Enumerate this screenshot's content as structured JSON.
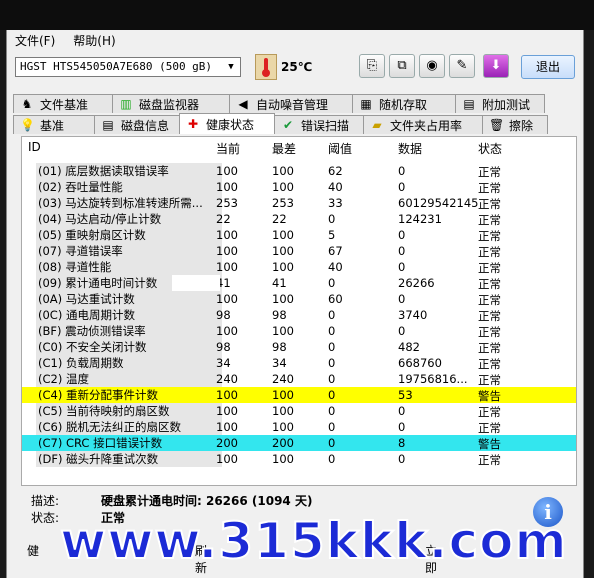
{
  "menu": {
    "file": "文件(F)",
    "help": "帮助(H)"
  },
  "toolbar": {
    "drive": "HGST HTS545050A7E680 (500 gB)",
    "temperature": "25℃",
    "exit_label": "退出"
  },
  "tabs_top": [
    {
      "label": "文件基准",
      "icon": "file-benchmark-icon"
    },
    {
      "label": "磁盘监视器",
      "icon": "disk-monitor-icon"
    },
    {
      "label": "自动噪音管理",
      "icon": "speaker-icon"
    },
    {
      "label": "随机存取",
      "icon": "random-access-icon"
    },
    {
      "label": "附加测试",
      "icon": "extra-tests-icon"
    }
  ],
  "tabs_bottom": [
    {
      "label": "基准",
      "icon": "benchmark-icon"
    },
    {
      "label": "磁盘信息",
      "icon": "disk-info-icon"
    },
    {
      "label": "健康状态",
      "icon": "health-icon"
    },
    {
      "label": "错误扫描",
      "icon": "error-scan-icon"
    },
    {
      "label": "文件夹占用率",
      "icon": "folder-usage-icon"
    },
    {
      "label": "擦除",
      "icon": "erase-icon"
    }
  ],
  "table": {
    "headers": [
      "ID",
      "当前",
      "最差",
      "阈值",
      "数据",
      "状态"
    ],
    "rows": [
      {
        "id": "(01) 底层数据读取错误率",
        "cur": "100",
        "worst": "100",
        "thr": "62",
        "data": "0",
        "status": "正常"
      },
      {
        "id": "(02) 吞吐量性能",
        "cur": "100",
        "worst": "100",
        "thr": "40",
        "data": "0",
        "status": "正常"
      },
      {
        "id": "(03) 马达旋转到标准转速所需...",
        "cur": "253",
        "worst": "253",
        "thr": "33",
        "data": "60129542145",
        "status": "正常"
      },
      {
        "id": "(04) 马达启动/停止计数",
        "cur": "22",
        "worst": "22",
        "thr": "0",
        "data": "124231",
        "status": "正常"
      },
      {
        "id": "(05) 重映射扇区计数",
        "cur": "100",
        "worst": "100",
        "thr": "5",
        "data": "0",
        "status": "正常"
      },
      {
        "id": "(07) 寻道错误率",
        "cur": "100",
        "worst": "100",
        "thr": "67",
        "data": "0",
        "status": "正常"
      },
      {
        "id": "(08) 寻道性能",
        "cur": "100",
        "worst": "100",
        "thr": "40",
        "data": "0",
        "status": "正常"
      },
      {
        "id": "(09) 累计通电时间计数",
        "cur": "41",
        "worst": "41",
        "thr": "0",
        "data": "26266",
        "status": "正常"
      },
      {
        "id": "(0A) 马达重试计数",
        "cur": "100",
        "worst": "100",
        "thr": "60",
        "data": "0",
        "status": "正常"
      },
      {
        "id": "(0C) 通电周期计数",
        "cur": "98",
        "worst": "98",
        "thr": "0",
        "data": "3740",
        "status": "正常"
      },
      {
        "id": "(BF) 震动侦测错误率",
        "cur": "100",
        "worst": "100",
        "thr": "0",
        "data": "0",
        "status": "正常"
      },
      {
        "id": "(C0) 不安全关闭计数",
        "cur": "98",
        "worst": "98",
        "thr": "0",
        "data": "482",
        "status": "正常"
      },
      {
        "id": "(C1) 负载周期数",
        "cur": "34",
        "worst": "34",
        "thr": "0",
        "data": "668760",
        "status": "正常"
      },
      {
        "id": "(C2) 温度",
        "cur": "240",
        "worst": "240",
        "thr": "0",
        "data": "19756816...",
        "status": "正常"
      },
      {
        "id": "(C4) 重新分配事件计数",
        "cur": "100",
        "worst": "100",
        "thr": "0",
        "data": "53",
        "status": "警告"
      },
      {
        "id": "(C5) 当前待映射的扇区数",
        "cur": "100",
        "worst": "100",
        "thr": "0",
        "data": "0",
        "status": "正常"
      },
      {
        "id": "(C6) 脱机无法纠正的扇区数",
        "cur": "100",
        "worst": "100",
        "thr": "0",
        "data": "0",
        "status": "正常"
      },
      {
        "id": "(C7) CRC 接口错误计数",
        "cur": "200",
        "worst": "200",
        "thr": "0",
        "data": "8",
        "status": "警告"
      },
      {
        "id": "(DF) 磁头升降重试次数",
        "cur": "100",
        "worst": "100",
        "thr": "0",
        "data": "0",
        "status": "正常"
      }
    ]
  },
  "description": {
    "desc_label": "描述:",
    "desc_value": "硬盘累计通电时间: 26266 (1094 天)",
    "status_label": "状态:",
    "status_value": "正常"
  },
  "bottom": {
    "left": "健",
    "mid": "刷新",
    "right": "立即"
  },
  "watermark": "www.315kkk.com",
  "colors": {
    "warning_yellow": "#ffff00",
    "warning_cyan": "#33e6ee",
    "watermark": "#1c2bd6"
  }
}
